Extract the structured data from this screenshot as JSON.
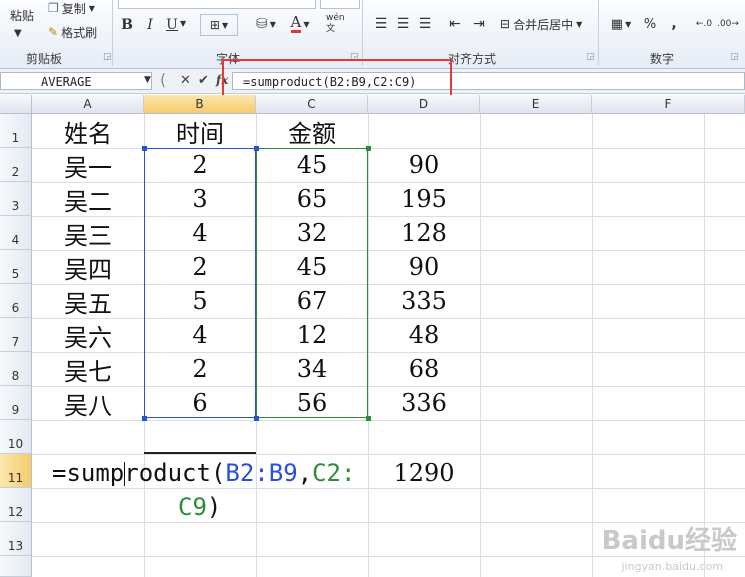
{
  "ribbon": {
    "paste": "粘贴",
    "copy": "复制",
    "format_painter": "格式刷",
    "clipboard_group": "剪贴板",
    "font_group": "字体",
    "align_group": "对齐方式",
    "number_group": "数字",
    "bold": "B",
    "italic": "I",
    "underline": "U",
    "merge_center": "合并后居中",
    "percent": "%",
    "comma": ",",
    "fill_icon": "paint-bucket-icon",
    "font_color": "A",
    "wen": "wén 文"
  },
  "formula_bar": {
    "name_box": "AVERAGE",
    "formula": "=sumproduct(B2:B9,C2:C9)",
    "cancel": "✕",
    "enter": "✔",
    "fx": "fx"
  },
  "columns": [
    "A",
    "B",
    "C",
    "D",
    "E",
    "F"
  ],
  "rows": [
    "1",
    "2",
    "3",
    "4",
    "5",
    "6",
    "7",
    "8",
    "9",
    "10",
    "11",
    "12",
    "13"
  ],
  "table": {
    "headers": [
      "姓名",
      "时间",
      "金额"
    ],
    "data": [
      [
        "吴一",
        "2",
        "45",
        "90"
      ],
      [
        "吴二",
        "3",
        "65",
        "195"
      ],
      [
        "吴三",
        "4",
        "32",
        "128"
      ],
      [
        "吴四",
        "2",
        "45",
        "90"
      ],
      [
        "吴五",
        "5",
        "67",
        "335"
      ],
      [
        "吴六",
        "4",
        "12",
        "48"
      ],
      [
        "吴七",
        "2",
        "34",
        "68"
      ],
      [
        "吴八",
        "6",
        "56",
        "336"
      ]
    ]
  },
  "editing": {
    "prefix": "=sumproduct(",
    "ref1": "B2:B9",
    "sep": ",",
    "ref2_line1": "C2:",
    "ref2_line2": "C9",
    "suffix": ")"
  },
  "d11_value": "1290",
  "watermark": {
    "brand": "Baidu经验",
    "url": "jingyan.baidu.com"
  }
}
